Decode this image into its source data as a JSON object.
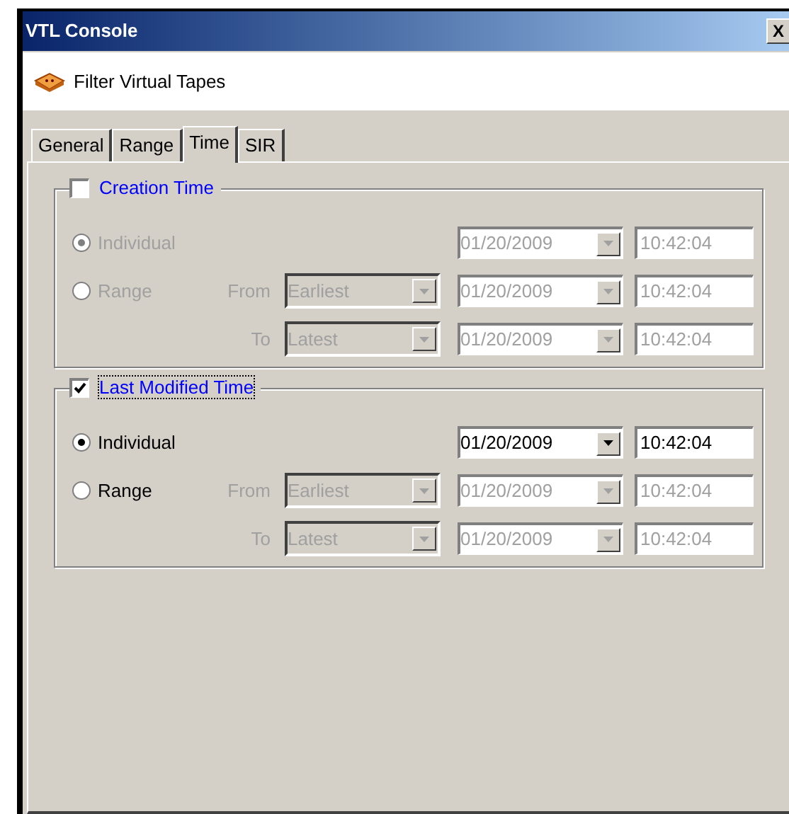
{
  "window": {
    "title": "VTL Console",
    "close": "X"
  },
  "header": {
    "title": "Filter Virtual Tapes"
  },
  "tabs": [
    {
      "label": "General",
      "selected": false
    },
    {
      "label": "Range",
      "selected": false
    },
    {
      "label": "Time",
      "selected": true
    },
    {
      "label": "SIR",
      "selected": false
    }
  ],
  "groups": [
    {
      "title": "Creation Time",
      "checked": false,
      "focused": false,
      "rows": [
        {
          "kind": "individual",
          "label": "Individual",
          "selected": true,
          "date": "01/20/2009",
          "time": "10:42:04"
        },
        {
          "kind": "range",
          "label": "Range",
          "selected": false,
          "bounds": [
            {
              "label": "From",
              "choice": "Earliest",
              "date": "01/20/2009",
              "time": "10:42:04"
            },
            {
              "label": "To",
              "choice": "Latest",
              "date": "01/20/2009",
              "time": "10:42:04"
            }
          ]
        }
      ]
    },
    {
      "title": "Last Modified Time",
      "checked": true,
      "focused": true,
      "rows": [
        {
          "kind": "individual",
          "label": "Individual",
          "selected": true,
          "date": "01/20/2009",
          "time": "10:42:04"
        },
        {
          "kind": "range",
          "label": "Range",
          "selected": false,
          "bounds": [
            {
              "label": "From",
              "choice": "Earliest",
              "date": "01/20/2009",
              "time": "10:42:04"
            },
            {
              "label": "To",
              "choice": "Latest",
              "date": "01/20/2009",
              "time": "10:42:04"
            }
          ]
        }
      ]
    }
  ]
}
